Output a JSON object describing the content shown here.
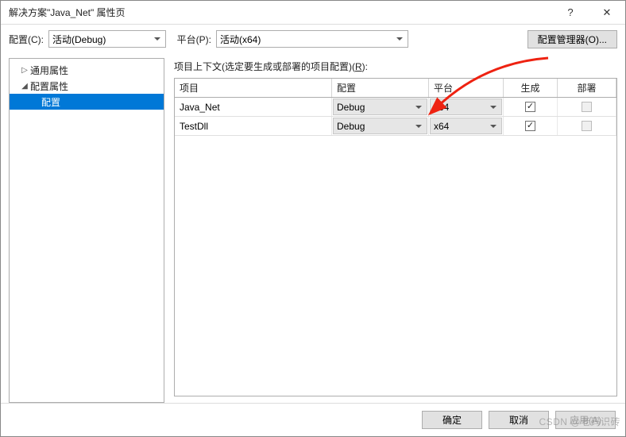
{
  "window": {
    "title": "解决方案\"Java_Net\" 属性页",
    "help_glyph": "?",
    "close_glyph": "✕"
  },
  "toolbar": {
    "config_label": "配置(C):",
    "config_value": "活动(Debug)",
    "platform_label": "平台(P):",
    "platform_value": "活动(x64)",
    "config_manager_btn": "配置管理器(O)..."
  },
  "tree": {
    "common": "通用属性",
    "config_props": "配置属性",
    "config": "配置"
  },
  "content": {
    "context_label_prefix": "项目上下文(选定要生成或部署的项目配置)(",
    "context_label_u": "R",
    "context_label_suffix": "):",
    "columns": {
      "project": "项目",
      "config": "配置",
      "platform": "平台",
      "build": "生成",
      "deploy": "部署"
    },
    "rows": [
      {
        "project": "Java_Net",
        "config": "Debug",
        "platform": "x64",
        "build": true,
        "deploy": false,
        "deploy_enabled": false
      },
      {
        "project": "TestDll",
        "config": "Debug",
        "platform": "x64",
        "build": true,
        "deploy": false,
        "deploy_enabled": false
      }
    ]
  },
  "footer": {
    "ok": "确定",
    "cancel": "取消",
    "apply": "应用(A)"
  },
  "watermark": "CSDN @老码识砖"
}
